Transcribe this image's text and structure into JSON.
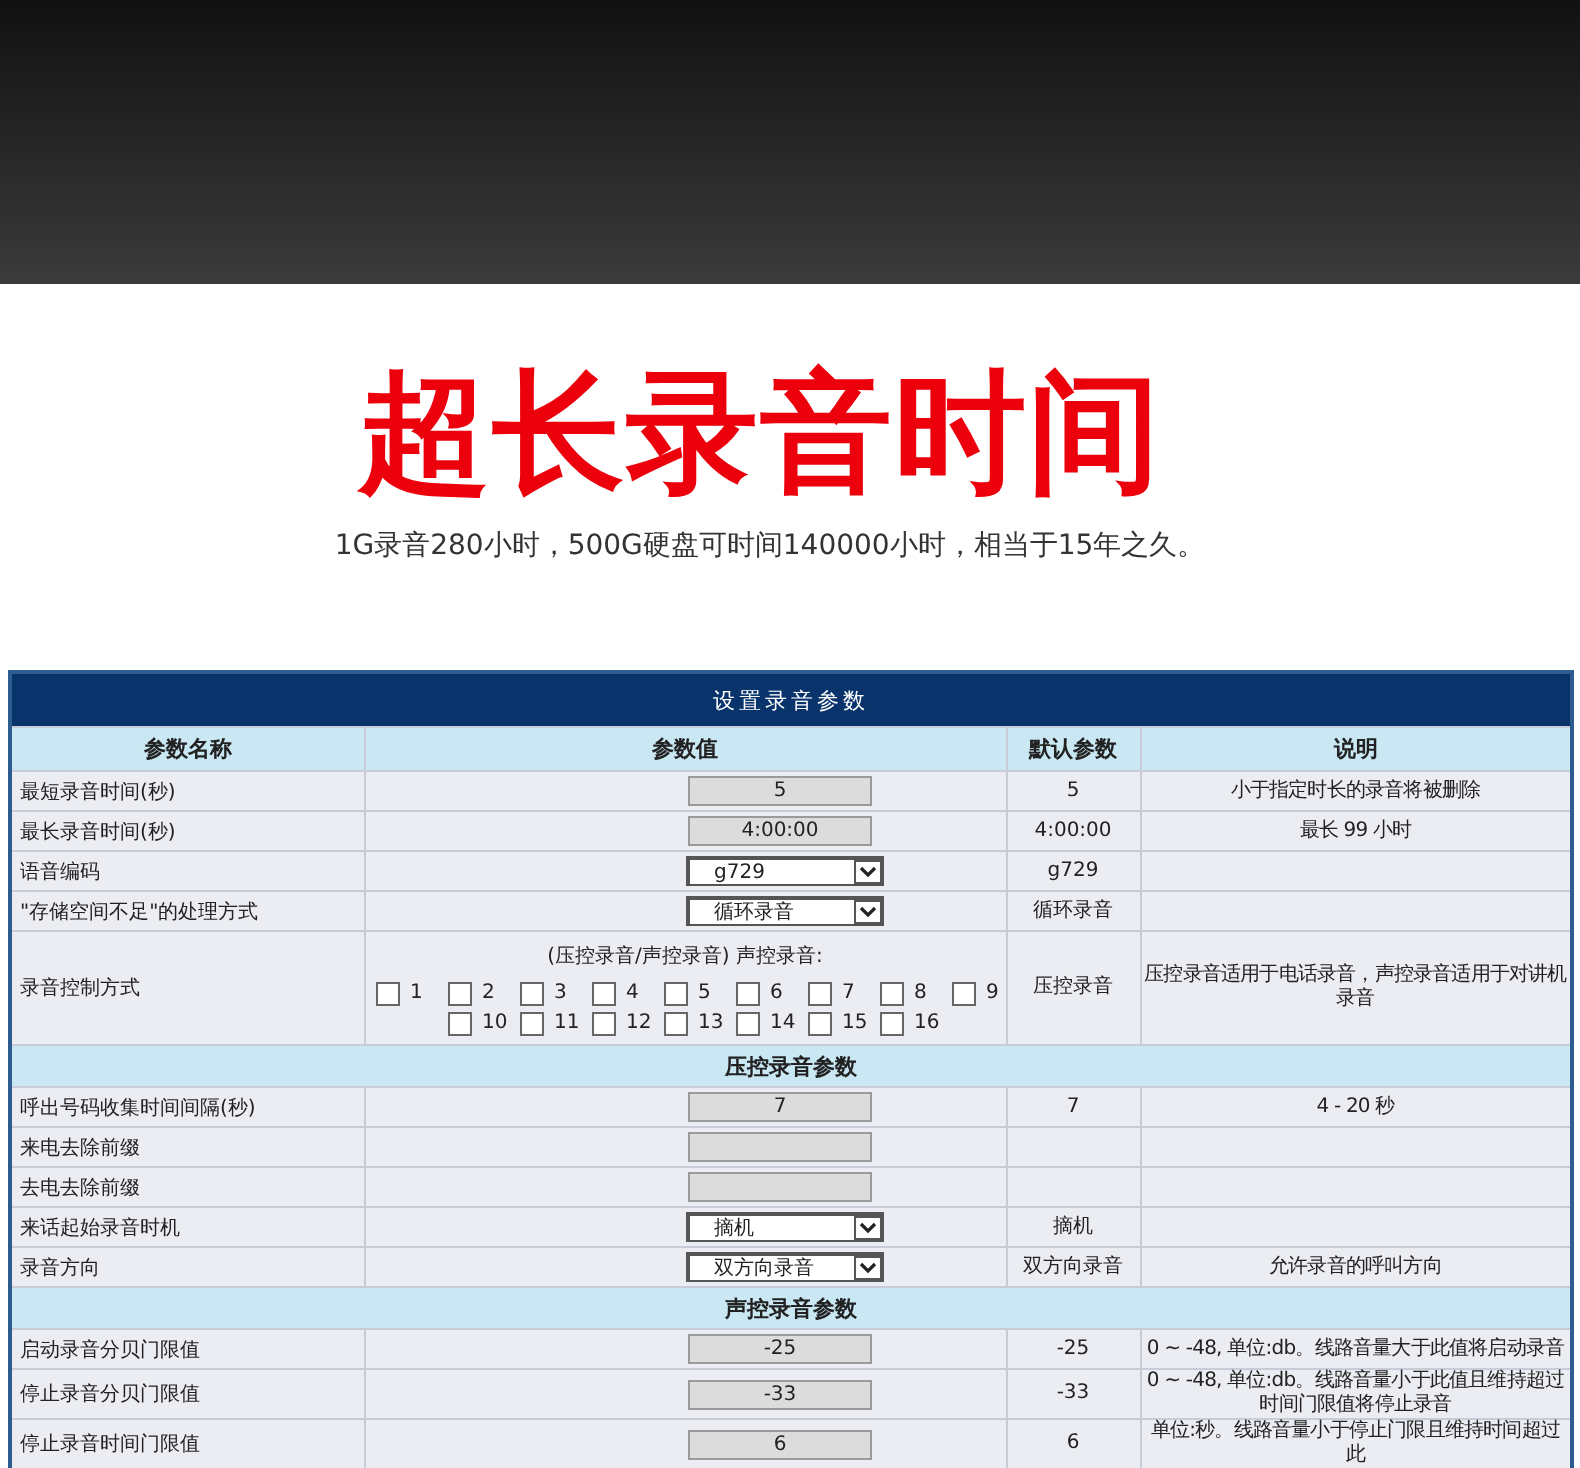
{
  "banner": {
    "headline": "超长录音时间",
    "subtitle": "1G录音280小时，500G硬盘可时间140000小时，相当于15年之久。"
  },
  "table": {
    "title": "设置录音参数",
    "columns": [
      "参数名称",
      "参数值",
      "默认参数",
      "说明"
    ],
    "rows": [
      {
        "kind": "field",
        "name": "最短录音时间(秒)",
        "value": "5",
        "default": "5",
        "note": "小于指定时长的录音将被删除"
      },
      {
        "kind": "field",
        "name": "最长录音时间(秒)",
        "value": "4:00:00",
        "default": "4:00:00",
        "note": "最长 99 小时"
      },
      {
        "kind": "select",
        "name": "语音编码",
        "value": "g729",
        "default": "g729"
      },
      {
        "kind": "select",
        "name": "\"存储空间不足\"的处理方式",
        "value": "循环录音",
        "default": "循环录音"
      },
      {
        "kind": "checkboxes",
        "name": "录音控制方式",
        "caption": "(压控录音/声控录音) 声控录音:",
        "options": [
          {
            "label": "1",
            "checked": false
          },
          {
            "label": "2",
            "checked": false
          },
          {
            "label": "3",
            "checked": false
          },
          {
            "label": "4",
            "checked": false
          },
          {
            "label": "5",
            "checked": false
          },
          {
            "label": "6",
            "checked": false
          },
          {
            "label": "7",
            "checked": false
          },
          {
            "label": "8",
            "checked": false
          },
          {
            "label": "9",
            "checked": false
          },
          {
            "label": "10",
            "checked": false
          },
          {
            "label": "11",
            "checked": false
          },
          {
            "label": "12",
            "checked": false
          },
          {
            "label": "13",
            "checked": false
          },
          {
            "label": "14",
            "checked": false
          },
          {
            "label": "15",
            "checked": false
          },
          {
            "label": "16",
            "checked": false
          }
        ],
        "default": "压控录音",
        "note": "压控录音适用于电话录音，声控录音适用于对讲机录音"
      },
      {
        "kind": "section",
        "title": "压控录音参数"
      },
      {
        "kind": "field",
        "name": "呼出号码收集时间间隔(秒)",
        "value": "7",
        "default": "7",
        "note": "4 - 20 秒"
      },
      {
        "kind": "field",
        "name": "来电去除前缀"
      },
      {
        "kind": "field",
        "name": "去电去除前缀"
      },
      {
        "kind": "select",
        "name": "来话起始录音时机",
        "value": "摘机",
        "default": "摘机"
      },
      {
        "kind": "select",
        "name": "录音方向",
        "value": "双方向录音",
        "default": "双方向录音",
        "note": "允许录音的呼叫方向"
      },
      {
        "kind": "section",
        "title": "声控录音参数"
      },
      {
        "kind": "field",
        "name": "启动录音分贝门限值",
        "value": "-25",
        "default": "-25",
        "note": "0 ~ -48, 单位:db。线路音量大于此值将启动录音"
      },
      {
        "kind": "field",
        "name": "停止录音分贝门限值",
        "value": "-33",
        "default": "-33",
        "note": "0 ~ -48, 单位:db。线路音量小于此值且维持超过时间门限值将停止录音"
      },
      {
        "kind": "field",
        "name": "停止录音时间门限值",
        "value": "6",
        "default": "6",
        "note": "单位:秒。线路音量小于停止门限且维持时间超过此"
      }
    ]
  }
}
